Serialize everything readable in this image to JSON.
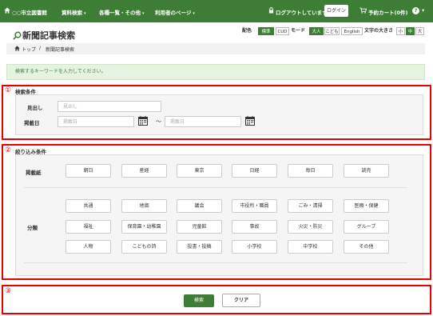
{
  "nav": {
    "home_label": "○○市立図書館",
    "menu1": "資料検索",
    "menu2": "各種一覧・その他",
    "menu3": "利用者のページ",
    "logout_status": "ログアウトしています",
    "login": "ログイン",
    "cart": "予約カート(0件)"
  },
  "page": {
    "title": "新聞記事検索"
  },
  "toolbar": {
    "color_label": "配色",
    "color_standard": "標準",
    "color_cud": "CUD",
    "mode_label": "モード",
    "mode_adult": "大人",
    "mode_child": "こども",
    "mode_english": "English",
    "size_label": "文字の大きさ",
    "size_small": "小",
    "size_medium": "中",
    "size_large": "大"
  },
  "breadcrumb": {
    "home": "トップ",
    "separator": "/",
    "current": "新聞記事検索"
  },
  "alert": {
    "message": "検索するキーワードを入力してください。"
  },
  "markers": {
    "one": "①",
    "two": "②",
    "three": "③"
  },
  "search_conditions": {
    "heading": "検索条件",
    "headline_label": "見出し",
    "headline_placeholder": "見出し",
    "date_label": "掲載日",
    "date_from_placeholder": "掲載日",
    "date_to_placeholder": "掲載日",
    "range_separator": "～"
  },
  "filter_conditions": {
    "heading": "絞り込み条件",
    "newspaper_label": "掲載紙",
    "newspapers": [
      "朝日",
      "産経",
      "東京",
      "日経",
      "毎日",
      "読売"
    ],
    "category_label": "分類",
    "categories": [
      "共通",
      "地価",
      "議会",
      "市役所・職員",
      "ごみ・清掃",
      "医療・保健",
      "福祉",
      "保育園・幼稚園",
      "児童館",
      "事故",
      "火災・防災",
      "グループ",
      "人物",
      "こどもの詩",
      "投書・投稿",
      "小学校",
      "中学校",
      "その他"
    ]
  },
  "actions": {
    "search": "検索",
    "clear": "クリア"
  },
  "colors": {
    "nav_green": "#3e7d36",
    "marker_red": "#e60000",
    "alert_bg": "#e6f3e0"
  }
}
